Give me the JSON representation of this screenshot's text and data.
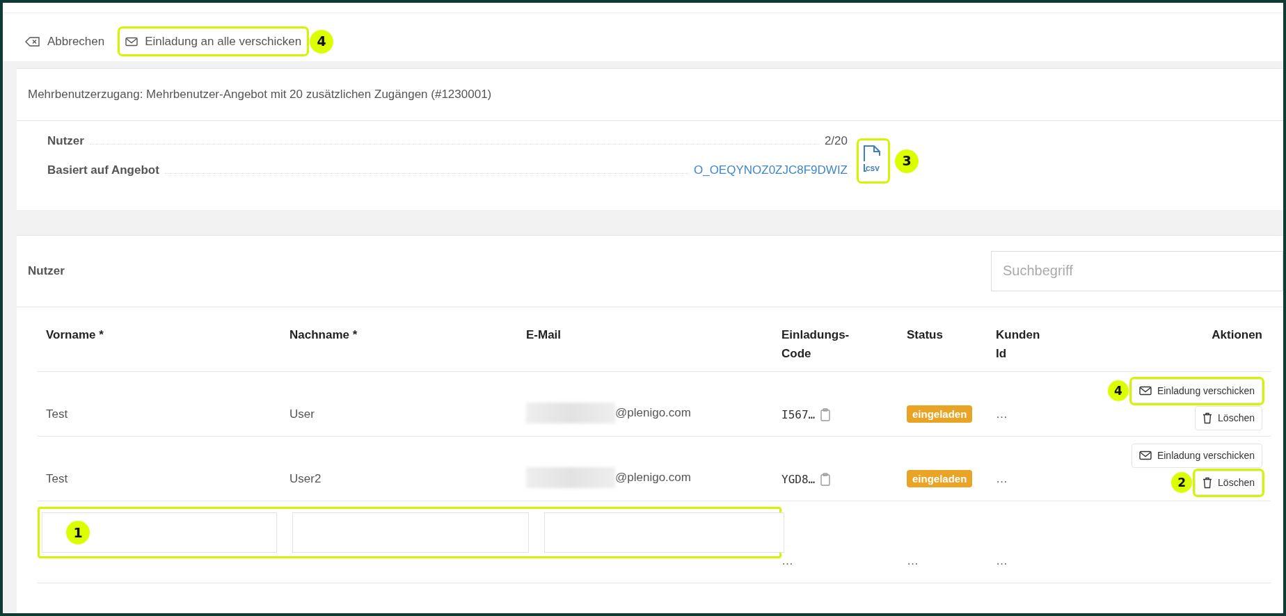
{
  "toolbar": {
    "buttons": [
      {
        "label": "Abbrechen",
        "kind": "cancel",
        "highlighted": false
      },
      {
        "label": "Einladung an alle verschicken",
        "kind": "invite",
        "highlighted": true,
        "callout": "4"
      }
    ]
  },
  "details": {
    "title": "Mehrbenutzerzugang: Mehrbenutzer-Angebot mit 20 zusätzlichen Zugängen (#1230001)",
    "fields": [
      {
        "label": "Nutzer",
        "value": "2/20",
        "kind": "text"
      },
      {
        "label": "Basiert auf Angebot",
        "value": "O_OEQYNOZ0ZJC8F9DWIZ",
        "kind": "link"
      }
    ],
    "export": {
      "label": "CSV",
      "highlighted": true,
      "callout": "3"
    }
  },
  "users": {
    "title": "Nutzer",
    "search": {
      "placeholder": "Suchbegriff"
    },
    "columns": [
      "Vorname *",
      "Nachname *",
      "E-Mail",
      "Einladungs-Code",
      "Status",
      "Kunden Id",
      "Aktionen"
    ],
    "rows": [
      {
        "first_name": "Test",
        "last_name": "User",
        "email_redacted": true,
        "email": "@plenigo.com",
        "code": "I567…",
        "status": "eingeladen",
        "customer_id": "…",
        "actions": [
          {
            "label": "Einladung verschicken",
            "kind": "invite",
            "highlighted": true,
            "callout": "4"
          },
          {
            "label": "Löschen",
            "kind": "delete",
            "highlighted": false
          }
        ]
      },
      {
        "first_name": "Test",
        "last_name": "User2",
        "email_redacted": true,
        "email": "@plenigo.com",
        "code": "YGD8…",
        "status": "eingeladen",
        "customer_id": "…",
        "actions": [
          {
            "label": "Einladung verschicken",
            "kind": "invite",
            "highlighted": false
          },
          {
            "label": "Löschen",
            "kind": "delete",
            "highlighted": true,
            "callout": "2"
          }
        ]
      }
    ],
    "new_row": {
      "highlighted": true,
      "callout": "1",
      "code": "…",
      "status": "…",
      "customer_id": "…"
    }
  }
}
